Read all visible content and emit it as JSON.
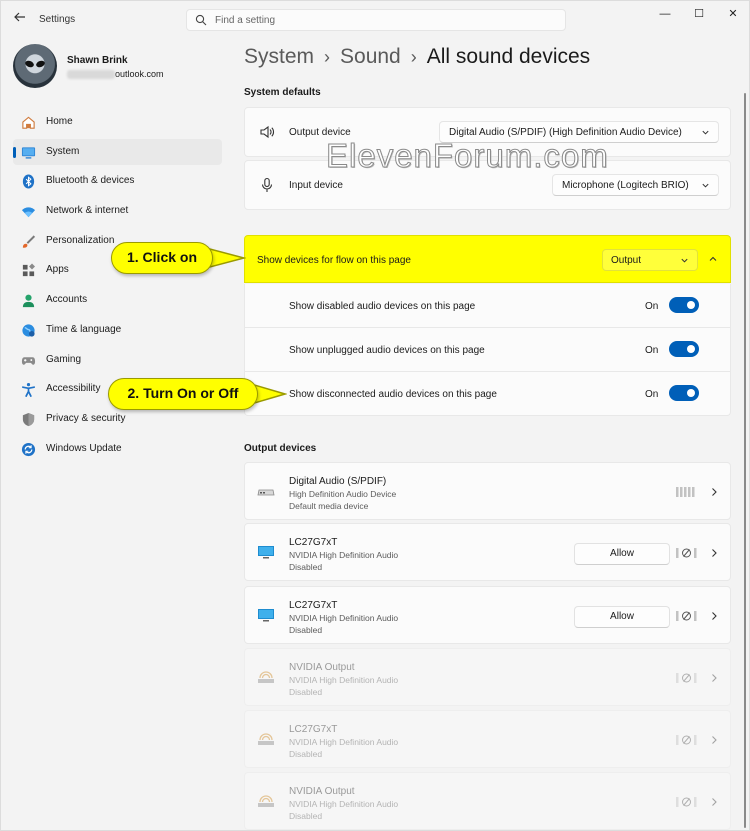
{
  "window": {
    "app_title": "Settings",
    "search_placeholder": "Find a setting",
    "controls": [
      "—",
      "☐",
      "✕"
    ]
  },
  "profile": {
    "name": "Shawn Brink",
    "email_visible": "outlook.com"
  },
  "sidebar": {
    "items": [
      {
        "label": "Home",
        "icon": "home-icon"
      },
      {
        "label": "System",
        "icon": "system-icon",
        "selected": true
      },
      {
        "label": "Bluetooth & devices",
        "icon": "bluetooth-icon"
      },
      {
        "label": "Network & internet",
        "icon": "wifi-icon"
      },
      {
        "label": "Personalization",
        "icon": "brush-icon"
      },
      {
        "label": "Apps",
        "icon": "apps-icon"
      },
      {
        "label": "Accounts",
        "icon": "accounts-icon"
      },
      {
        "label": "Time & language",
        "icon": "globe-icon"
      },
      {
        "label": "Gaming",
        "icon": "gamepad-icon"
      },
      {
        "label": "Accessibility",
        "icon": "accessibility-icon"
      },
      {
        "label": "Privacy & security",
        "icon": "shield-icon"
      },
      {
        "label": "Windows Update",
        "icon": "update-icon"
      }
    ]
  },
  "breadcrumb": {
    "parts": [
      "System",
      "Sound"
    ],
    "current": "All sound devices"
  },
  "system_defaults": {
    "title": "System defaults",
    "output": {
      "label": "Output device",
      "value": "Digital Audio (S/PDIF) (High Definition Audio Device)"
    },
    "input": {
      "label": "Input device",
      "value": "Microphone (Logitech BRIO)"
    }
  },
  "flow": {
    "label": "Show devices for flow on this page",
    "value": "Output",
    "options": [
      {
        "label": "Show disabled audio devices on this page",
        "state": "On"
      },
      {
        "label": "Show unplugged audio devices on this page",
        "state": "On"
      },
      {
        "label": "Show disconnected audio devices on this page",
        "state": "On"
      }
    ]
  },
  "output_devices": {
    "title": "Output devices",
    "allow_label": "Allow",
    "items": [
      {
        "name": "Digital Audio (S/PDIF)",
        "sub1": "High Definition Audio Device",
        "sub2": "Default media device",
        "icon": "speaker-box-icon"
      },
      {
        "name": "LC27G7xT",
        "sub1": "NVIDIA High Definition Audio",
        "sub2": "Disabled",
        "icon": "monitor-icon"
      },
      {
        "name": "LC27G7xT",
        "sub1": "NVIDIA High Definition Audio",
        "sub2": "Disabled",
        "icon": "monitor-icon"
      },
      {
        "name": "NVIDIA Output",
        "sub1": "NVIDIA High Definition Audio",
        "sub2": "Disabled",
        "icon": "output-device-icon"
      },
      {
        "name": "LC27G7xT",
        "sub1": "NVIDIA High Definition Audio",
        "sub2": "Disabled",
        "icon": "output-device-icon"
      },
      {
        "name": "NVIDIA Output",
        "sub1": "NVIDIA High Definition Audio",
        "sub2": "Disabled",
        "icon": "output-device-icon"
      }
    ]
  },
  "callouts": {
    "one": "1. Click on",
    "two": "2. Turn On or Off"
  },
  "watermark": "ElevenForum.com",
  "colors": {
    "accent": "#005fb8",
    "highlight": "#ffff00"
  }
}
